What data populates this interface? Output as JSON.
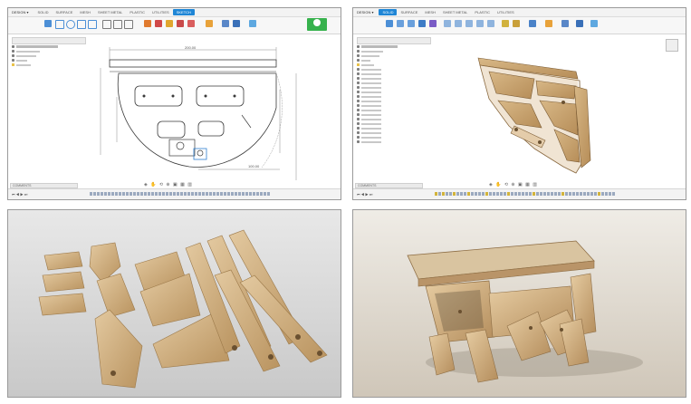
{
  "colors": {
    "accent_blue": "#1f86d6",
    "finish_green": "#37b24d",
    "wood": "#c9a876",
    "wood_dark": "#a37f4f",
    "sketch_line": "#3a3a3a",
    "dimension_line": "#8a8a8a"
  },
  "panels": {
    "sketch_view": {
      "design_dropdown": "DESIGN ▾",
      "tabs": [
        "SOLID",
        "SURFACE",
        "MESH",
        "SHEET METAL",
        "PLASTIC",
        "UTILITIES",
        "SKETCH"
      ],
      "active_tab": "SKETCH",
      "dimensions": [
        "200.00",
        "100.00"
      ],
      "comments_label": "COMMENTS"
    },
    "model_view": {
      "design_dropdown": "DESIGN ▾",
      "tabs": [
        "SOLID",
        "SURFACE",
        "MESH",
        "SHEET METAL",
        "PLASTIC",
        "UTILITIES"
      ],
      "active_tab": "SOLID",
      "comments_label": "COMMENTS"
    },
    "parts_render": {
      "caption": ""
    },
    "assembled_render": {
      "caption": ""
    }
  },
  "icons": {
    "finish_sketch": "check-icon",
    "play_controls": "timeline-play-icon"
  }
}
